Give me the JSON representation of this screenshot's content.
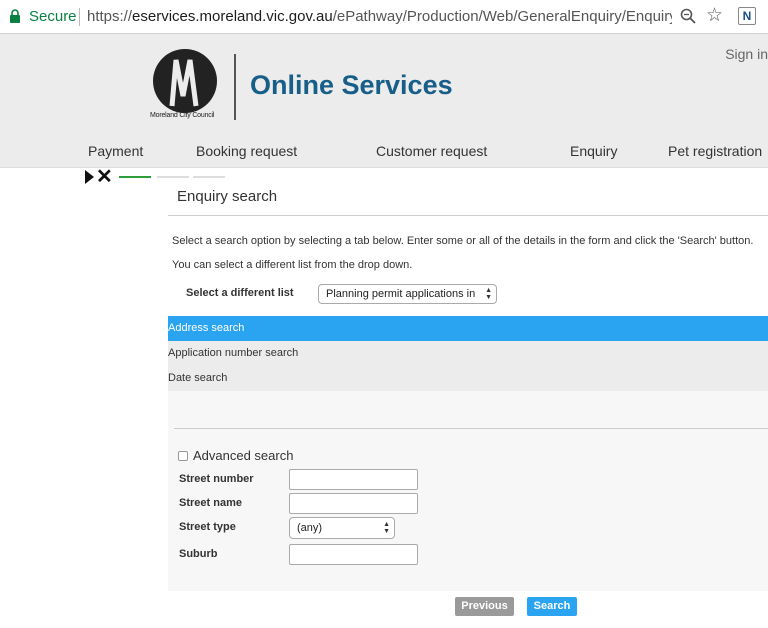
{
  "browser": {
    "secure_label": "Secure",
    "url_scheme": "https://",
    "url_host": "eservices.moreland.vic.gov.au",
    "url_path": "/ePathway/Production/Web/GeneralEnquiry/Enquiry...",
    "extension_letter": "N"
  },
  "header": {
    "sign_in": "Sign in",
    "council_name": "Moreland City Council",
    "site_title": "Online Services",
    "brand_color": "#175e88"
  },
  "nav": {
    "items": [
      "Payment",
      "Booking request",
      "Customer request",
      "Enquiry",
      "Pet registration"
    ]
  },
  "progress": {
    "steps_total": 4,
    "steps_completed": 1
  },
  "main": {
    "title": "Enquiry search",
    "instructions": "Select a search option by selecting a tab below. Enter some or all of the details in the form and click the 'Search' button.",
    "list_hint": "You can select a different list from the drop down.",
    "list_label": "Select a different list",
    "list_selected": "Planning permit applications in",
    "tabs": [
      "Address search",
      "Application number search",
      "Date search"
    ],
    "active_tab": "Address search",
    "active_color": "#2aa3f0"
  },
  "form": {
    "advanced_label": "Advanced search",
    "street_number_label": "Street number",
    "street_name_label": "Street name",
    "street_type_label": "Street type",
    "street_type_value": "(any)",
    "suburb_label": "Suburb",
    "street_number_value": "",
    "street_name_value": "",
    "suburb_value": ""
  },
  "buttons": {
    "previous": "Previous",
    "search": "Search"
  }
}
